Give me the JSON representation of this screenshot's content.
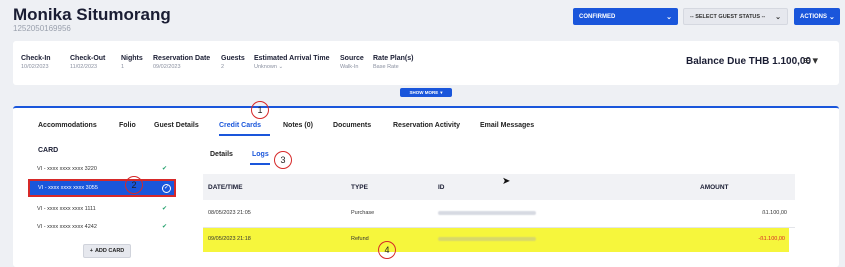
{
  "guest": {
    "name": "Monika Situmorang",
    "id": "1252050169956"
  },
  "header": {
    "status": "CONFIRMED",
    "guest_status": "-- SELECT GUEST STATUS --",
    "actions": "ACTIONS"
  },
  "summary": {
    "fields": [
      {
        "label": "Check-In",
        "value": "10/02/2023"
      },
      {
        "label": "Check-Out",
        "value": "11/02/2023"
      },
      {
        "label": "Nights",
        "value": "1"
      },
      {
        "label": "Reservation Date",
        "value": "09/02/2023"
      },
      {
        "label": "Guests",
        "value": "2"
      },
      {
        "label": "Estimated Arrival Time",
        "value": "Unknown"
      },
      {
        "label": "Source",
        "value": "Walk-In"
      },
      {
        "label": "Rate Plan(s)",
        "value": "Base Rate"
      }
    ],
    "balance": "Balance Due THB 1.100,00",
    "show_more": "SHOW MORE"
  },
  "tabs": [
    "Accommodations",
    "Folio",
    "Guest Details",
    "Credit Cards",
    "Notes (0)",
    "Documents",
    "Reservation Activity",
    "Email Messages"
  ],
  "card_panel": {
    "heading": "CARD",
    "cards": [
      "VI - xxxx xxxx xxxx 3220",
      "VI - xxxx xxxx xxxx 3055",
      "VI - xxxx xxxx xxxx 1111",
      "VI - xxxx xxxx xxxx 4242"
    ],
    "add_card": "ADD CARD"
  },
  "subtabs": [
    "Details",
    "Logs"
  ],
  "logs": {
    "columns": [
      "DATE/TIME",
      "TYPE",
      "ID",
      "AMOUNT"
    ],
    "rows": [
      {
        "datetime": "08/05/2023 21:05",
        "type": "Purchase",
        "amount": "ß1.100,00"
      },
      {
        "datetime": "09/05/2023 21:18",
        "type": "Refund",
        "amount": "-ß1.100,00"
      }
    ]
  },
  "annotations": [
    "1",
    "2",
    "3",
    "4"
  ],
  "colors": {
    "accent": "#1a56db",
    "highlight": "#f6f63c",
    "annotation": "#d62929",
    "success": "#22a06b"
  }
}
